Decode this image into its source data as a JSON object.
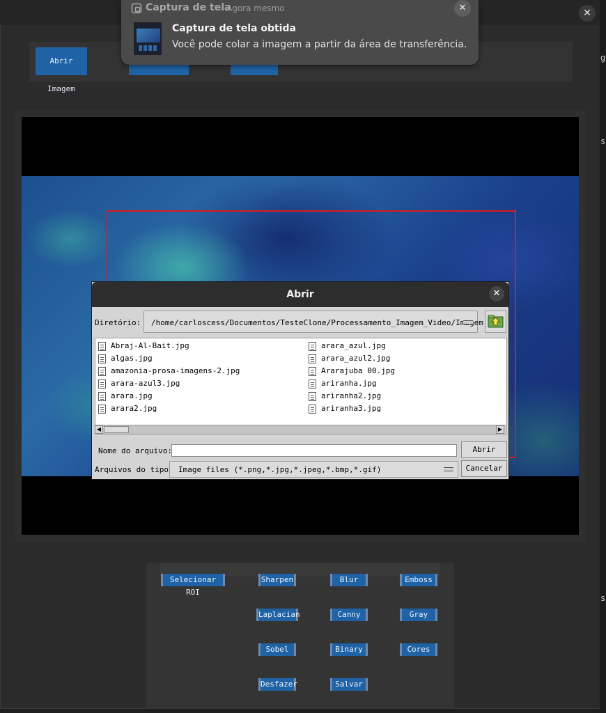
{
  "toast": {
    "app_name": "Captura de tela",
    "time": "Agora mesmo",
    "title": "Captura de tela obtida",
    "body": "Você pode colar a imagem a partir da área de transferência."
  },
  "toolbar": {
    "open_image": "Abrir Imagem"
  },
  "edge_glyphs": [
    "g",
    "s",
    "s"
  ],
  "dialog": {
    "title": "Abrir",
    "directory_label": "Diretório:",
    "directory_path": "/home/carloscess/Documentos/TesteClone/Processamento_Imagem_Video/Imagem",
    "files_col1": [
      "Abraj-Al-Bait.jpg",
      "algas.jpg",
      "amazonia-prosa-imagens-2.jpg",
      "arara-azul3.jpg",
      "arara.jpg",
      "arara2.jpg"
    ],
    "files_col2": [
      "arara_azul.jpg",
      "arara_azul2.jpg",
      "Ararajuba 00.jpg",
      "ariranha.jpg",
      "ariranha2.jpg",
      "ariranha3.jpg"
    ],
    "filename_label": "Nome do arquivo:",
    "filename_value": "",
    "open_button": "Abrir",
    "filetype_label": "Arquivos do tipo:",
    "filetype_value": "Image files (*.png,*.jpg,*.jpeg,*.bmp,*.gif)",
    "cancel_button": "Cancelar"
  },
  "operations": {
    "select_roi": "Selecionar ROI",
    "sharpen": "Sharpen",
    "blur": "Blur",
    "emboss": "Emboss",
    "laplacian": "Laplacian",
    "canny": "Canny",
    "gray": "Gray",
    "sobel": "Sobel",
    "binary": "Binary",
    "cores": "Cores",
    "desfazer": "Desfazer",
    "salvar": "Salvar"
  },
  "colors": {
    "button_blue": "#1f63a6",
    "roi_red": "#e01818"
  }
}
